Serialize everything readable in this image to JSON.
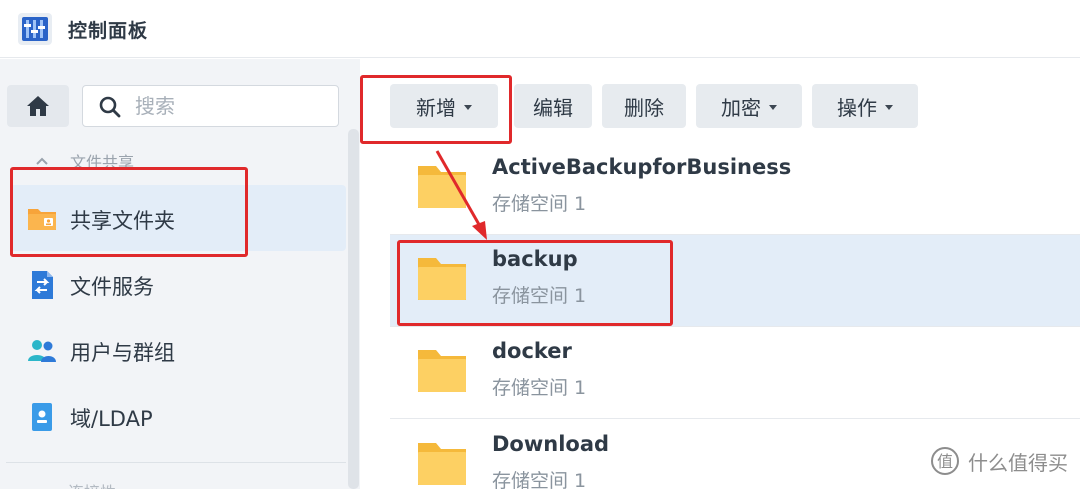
{
  "window": {
    "title": "控制面板"
  },
  "sidebar": {
    "search_placeholder": "搜索",
    "section_label": "文件共享",
    "items": [
      {
        "label": "共享文件夹",
        "icon": "shared-folder-icon",
        "active": true
      },
      {
        "label": "文件服务",
        "icon": "file-services-icon",
        "active": false
      },
      {
        "label": "用户与群组",
        "icon": "users-groups-icon",
        "active": false
      },
      {
        "label": "域/LDAP",
        "icon": "domain-ldap-icon",
        "active": false
      }
    ],
    "next_section_label": "连接性"
  },
  "toolbar": {
    "add_label": "新增",
    "edit_label": "编辑",
    "delete_label": "删除",
    "encrypt_label": "加密",
    "action_label": "操作"
  },
  "folders": [
    {
      "name": "ActiveBackupforBusiness",
      "volume": "存储空间 1",
      "selected": false
    },
    {
      "name": "backup",
      "volume": "存储空间 1",
      "selected": true
    },
    {
      "name": "docker",
      "volume": "存储空间 1",
      "selected": false
    },
    {
      "name": "Download",
      "volume": "存储空间 1",
      "selected": false
    }
  ],
  "watermark": {
    "text": "什么值得买"
  },
  "colors": {
    "accent_selection": "#e3edf8",
    "annotation_red": "#e0292b",
    "folder_yellow": "#fcc94d",
    "button_bg": "#e7ebef"
  }
}
